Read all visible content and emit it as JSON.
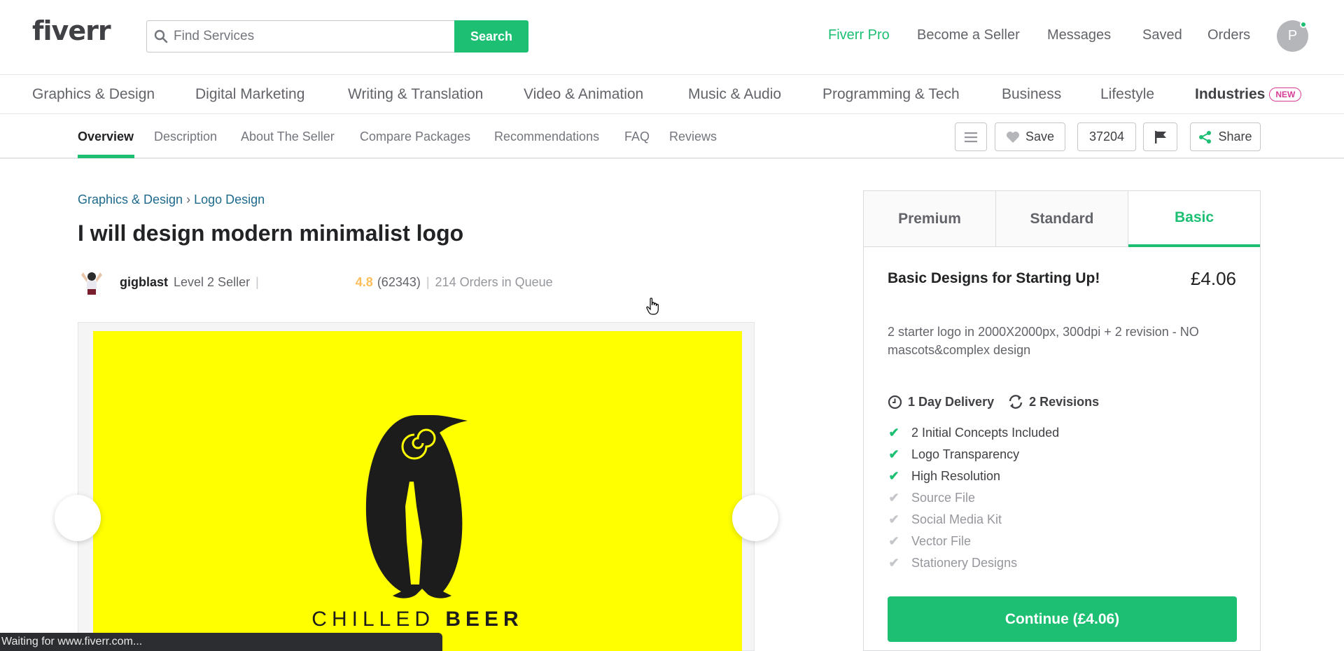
{
  "header": {
    "logo": "fiverr",
    "search_placeholder": "Find Services",
    "search_button": "Search",
    "nav": [
      "Fiverr Pro",
      "Become a Seller",
      "Messages",
      "Saved",
      "Orders"
    ],
    "avatar_letter": "P",
    "accent": "#1dbf73"
  },
  "categories": [
    "Graphics & Design",
    "Digital Marketing",
    "Writing & Translation",
    "Video & Animation",
    "Music & Audio",
    "Programming & Tech",
    "Business",
    "Lifestyle",
    "Industries"
  ],
  "new_badge": "NEW",
  "subnav": {
    "tabs": [
      "Overview",
      "Description",
      "About The Seller",
      "Compare Packages",
      "Recommendations",
      "FAQ",
      "Reviews"
    ],
    "save_label": "Save",
    "save_count": "37204",
    "share_label": "Share"
  },
  "gig": {
    "breadcrumb": [
      "Graphics & Design",
      "Logo Design"
    ],
    "breadcrumb_sep": "›",
    "title": "I will design modern minimalist logo",
    "seller": "gigblast",
    "level": "Level 2 Seller",
    "rating": "4.8",
    "reviews": "(62343)",
    "queue": "214 Orders in Queue",
    "image_text_light": "CHILLED",
    "image_text_bold": "BEER"
  },
  "package": {
    "tabs": [
      "Premium",
      "Standard",
      "Basic"
    ],
    "active_tab": "Basic",
    "name": "Basic Designs for Starting Up!",
    "price": "£4.06",
    "description": "2 starter logo in 2000X2000px, 300dpi + 2 revision - NO mascots&complex design",
    "delivery": "1 Day Delivery",
    "revisions": "2 Revisions",
    "features": [
      {
        "label": "2 Initial Concepts Included",
        "included": true
      },
      {
        "label": "Logo Transparency",
        "included": true
      },
      {
        "label": "High Resolution",
        "included": true
      },
      {
        "label": "Source File",
        "included": false
      },
      {
        "label": "Social Media Kit",
        "included": false
      },
      {
        "label": "Vector File",
        "included": false
      },
      {
        "label": "Stationery Designs",
        "included": false
      }
    ],
    "cta": "Continue (£4.06)"
  },
  "status_text": "Waiting for www.fiverr.com..."
}
